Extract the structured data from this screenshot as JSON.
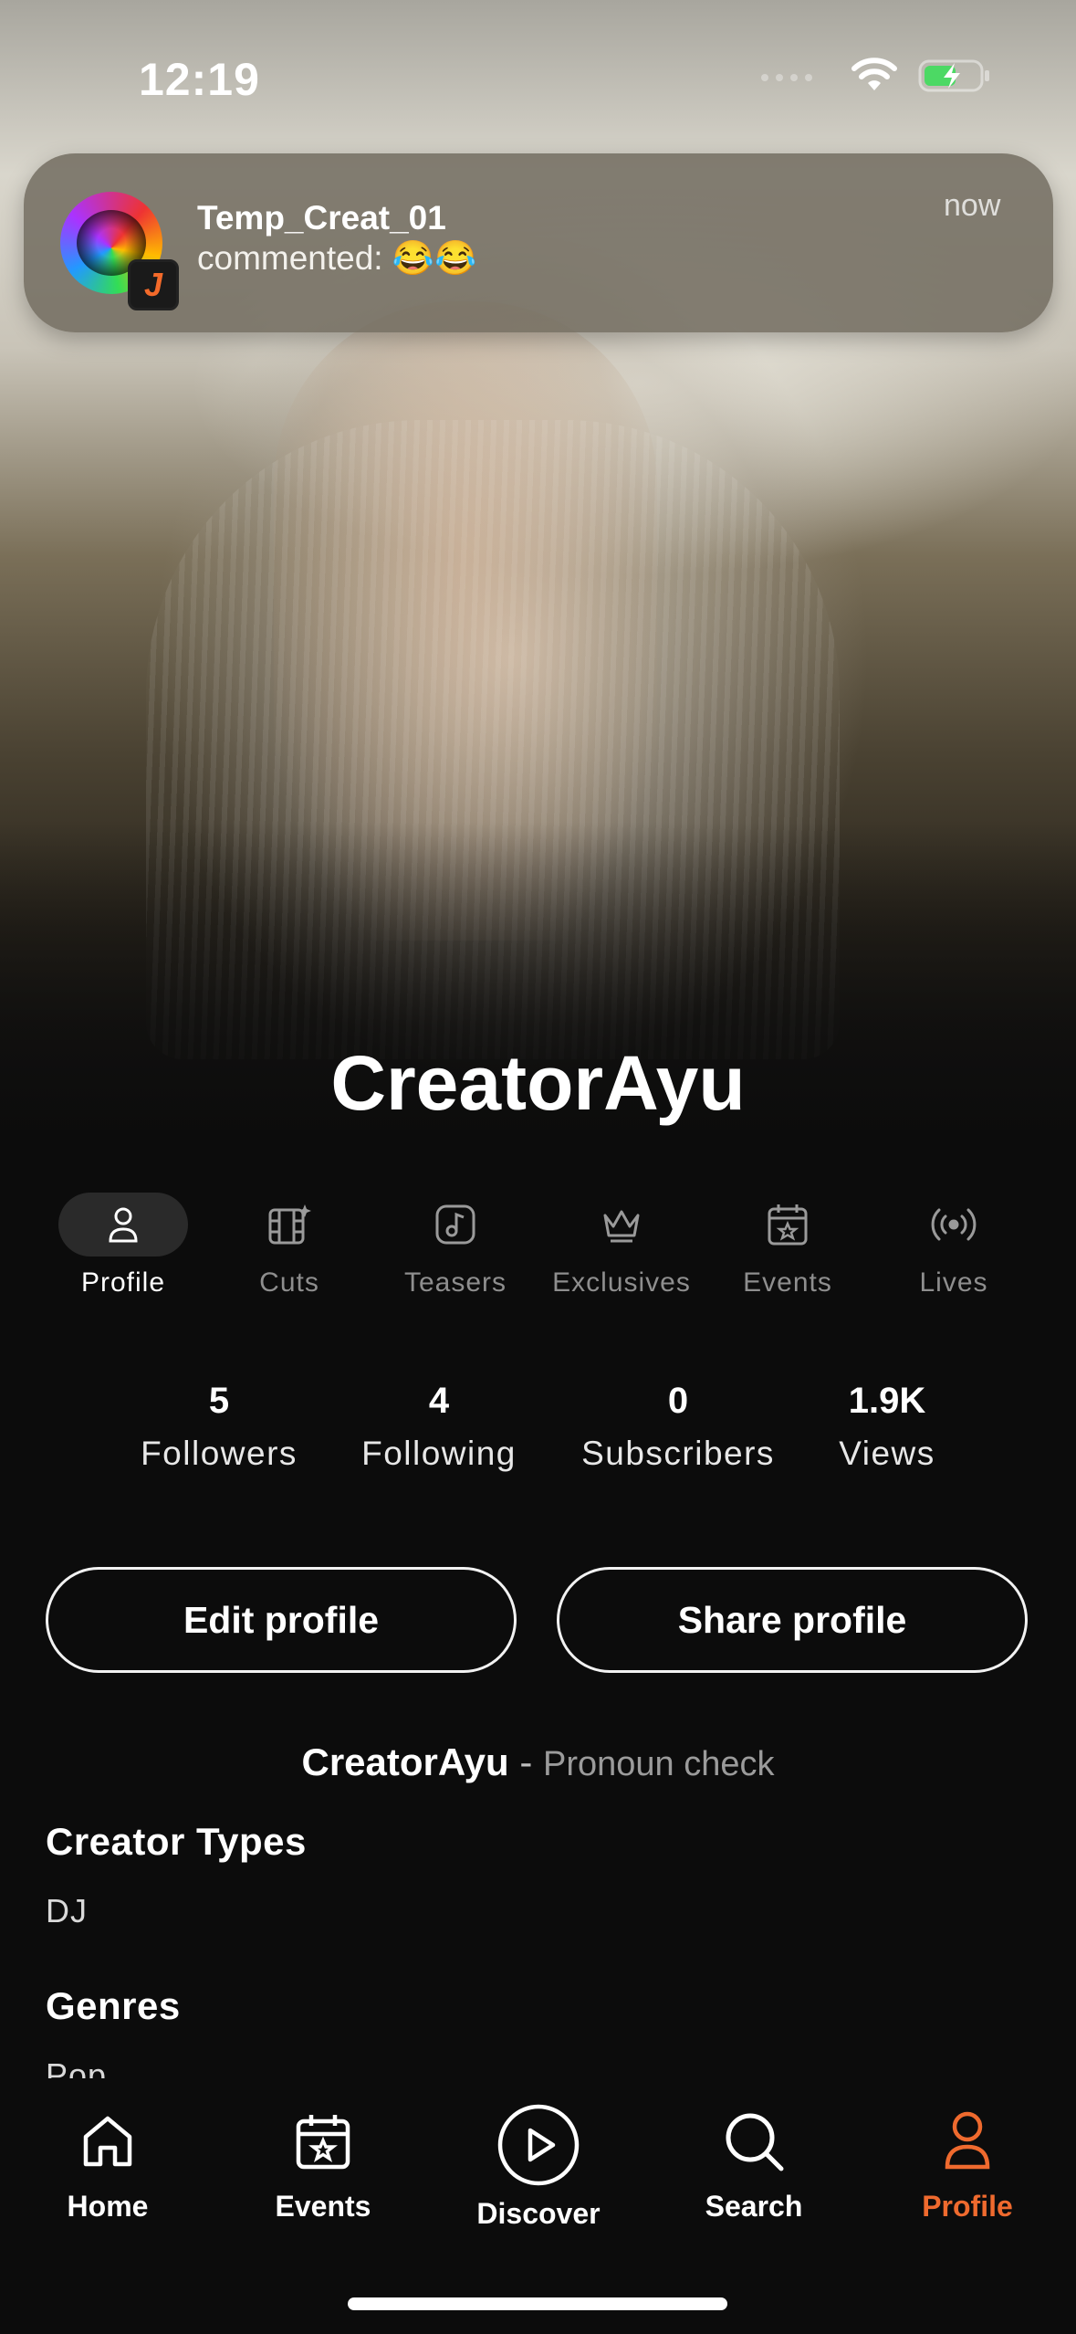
{
  "status_bar": {
    "time": "12:19"
  },
  "notification": {
    "title": "Temp_Creat_01",
    "body": "commented: 😂😂",
    "time": "now",
    "app_badge": "J"
  },
  "profile": {
    "name": "CreatorAyu",
    "tabs": [
      {
        "label": "Profile",
        "icon": "person-icon",
        "active": true
      },
      {
        "label": "Cuts",
        "icon": "film-sparkle-icon"
      },
      {
        "label": "Teasers",
        "icon": "music-note-icon"
      },
      {
        "label": "Exclusives",
        "icon": "crown-icon"
      },
      {
        "label": "Events",
        "icon": "calendar-star-icon"
      },
      {
        "label": "Lives",
        "icon": "broadcast-icon"
      }
    ],
    "stats": [
      {
        "value": "5",
        "label": "Followers"
      },
      {
        "value": "4",
        "label": "Following"
      },
      {
        "value": "0",
        "label": "Subscribers"
      },
      {
        "value": "1.9K",
        "label": "Views"
      }
    ],
    "edit_label": "Edit profile",
    "share_label": "Share profile",
    "bio_name": "CreatorAyu",
    "bio_separator": "-",
    "pronoun": "Pronoun check",
    "creator_types_heading": "Creator Types",
    "creator_types_value": "DJ",
    "genres_heading": "Genres",
    "genres_value": "Pop"
  },
  "bottom_nav": [
    {
      "label": "Home",
      "icon": "home-icon"
    },
    {
      "label": "Events",
      "icon": "calendar-star-icon"
    },
    {
      "label": "Discover",
      "icon": "play-circle-icon"
    },
    {
      "label": "Search",
      "icon": "search-icon"
    },
    {
      "label": "Profile",
      "icon": "person-icon",
      "active": true
    }
  ],
  "colors": {
    "accent": "#ef6a2e",
    "background": "#0c0c0c"
  }
}
